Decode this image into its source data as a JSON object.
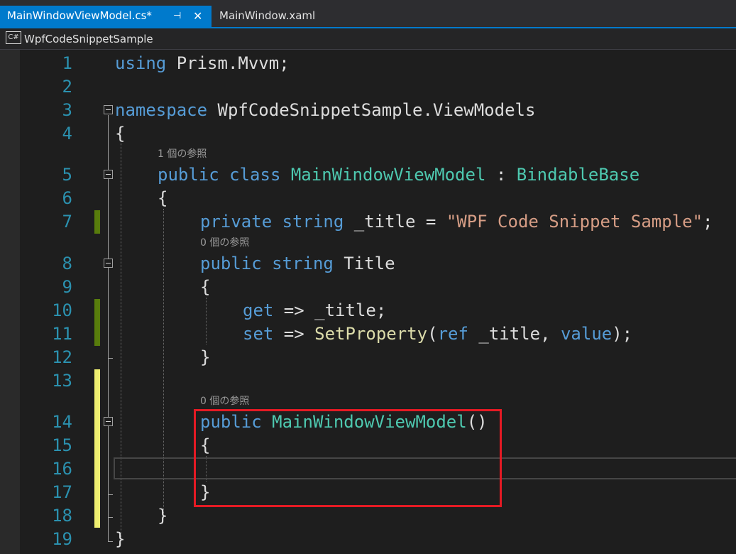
{
  "tabs": [
    {
      "label": "MainWindowViewModel.cs*",
      "active": true,
      "pin_icon": "pin-icon",
      "close_icon": "close-icon"
    },
    {
      "label": "MainWindow.xaml",
      "active": false
    }
  ],
  "navbar": {
    "project_icon": "C#",
    "project": "WpfCodeSnippetSample"
  },
  "colors": {
    "accent": "#007acc",
    "keyword": "#569cd6",
    "type": "#4ec9b0",
    "string": "#d69d85",
    "method": "#dcdcaa",
    "line_number": "#2b91af",
    "saved_change": "#587c0c",
    "unsaved_change": "#efef70",
    "highlight_box": "#e51a24"
  },
  "editor": {
    "line_numbers": [
      "1",
      "2",
      "3",
      "4",
      "5",
      "6",
      "7",
      "8",
      "9",
      "10",
      "11",
      "12",
      "13",
      "14",
      "15",
      "16",
      "17",
      "18",
      "19"
    ],
    "lenses": {
      "class_refs": "1 個の参照",
      "title_refs": "0 個の参照",
      "ctor_refs": "0 個の参照"
    },
    "code": {
      "l1_kw": "using",
      "l1_rest": " Prism.Mvvm;",
      "l3_kw": "namespace",
      "l3_rest": " WpfCodeSnippetSample.ViewModels",
      "l4": "{",
      "l5_kw1": "public",
      "l5_kw2": "class",
      "l5_type": "MainWindowViewModel",
      "l5_colon": " : ",
      "l5_base": "BindableBase",
      "l6": "{",
      "l7_kw1": "private",
      "l7_kw2": "string",
      "l7_mid": " _title = ",
      "l7_str": "\"WPF Code Snippet Sample\"",
      "l7_end": ";",
      "l8_kw1": "public",
      "l8_kw2": "string",
      "l8_rest": " Title",
      "l9": "{",
      "l10_kw": "get",
      "l10_rest": " => _title;",
      "l11_kw": "set",
      "l11_mid": " => ",
      "l11_method": "SetProperty",
      "l11_p1": "(",
      "l11_ref": "ref",
      "l11_p2": " _title, ",
      "l11_value": "value",
      "l11_end": ");",
      "l12": "}",
      "l14_kw": "public",
      "l14_type": "MainWindowViewModel",
      "l14_end": "()",
      "l15": "{",
      "l17": "}",
      "l18": "}",
      "l19": "}"
    }
  }
}
